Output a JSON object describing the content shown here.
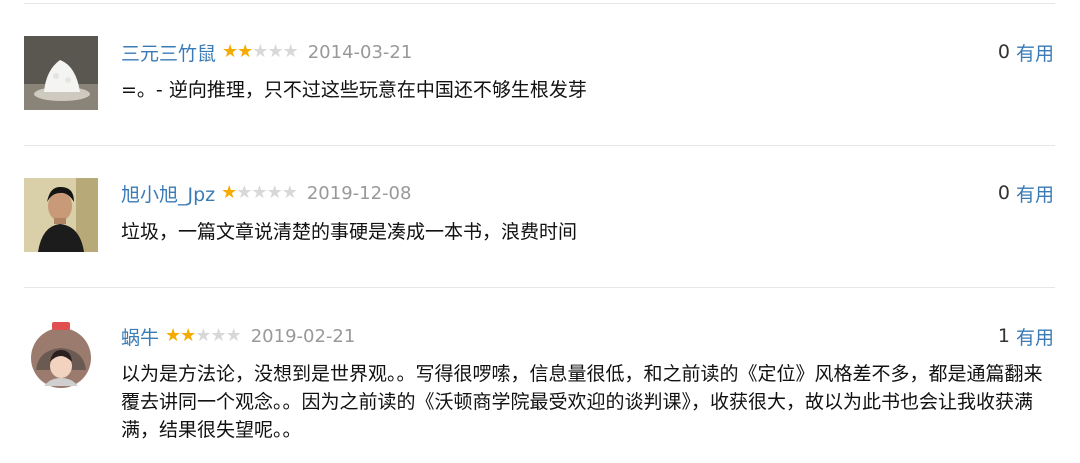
{
  "reviews": [
    {
      "author": "三元三竹鼠",
      "rating": 2,
      "date": "2014-03-21",
      "votes": "0",
      "useful_label": "有用",
      "content": "=。- 逆向推理，只不过这些玩意在中国还不够生根发芽"
    },
    {
      "author": "旭小旭_Jpz",
      "rating": 1,
      "date": "2019-12-08",
      "votes": "0",
      "useful_label": "有用",
      "content": "垃圾，一篇文章说清楚的事硬是凑成一本书，浪费时间"
    },
    {
      "author": "蜗牛",
      "rating": 2,
      "date": "2019-02-21",
      "votes": "1",
      "useful_label": "有用",
      "content": "以为是方法论，没想到是世界观。。写得很啰嗦，信息量很低，和之前读的《定位》风格差不多，都是通篇翻来覆去讲同一个观念。。因为之前读的《沃顿商学院最受欢迎的谈判课》，收获很大，故以为此书也会让我收获满满，结果很失望呢。。"
    }
  ],
  "colors": {
    "author": "#3a7bb6",
    "star_on": "#f6ab00",
    "star_off": "#d8d8d8",
    "date": "#999999",
    "separator": "#e6e6e6"
  },
  "icons": {
    "star": "star-icon"
  }
}
